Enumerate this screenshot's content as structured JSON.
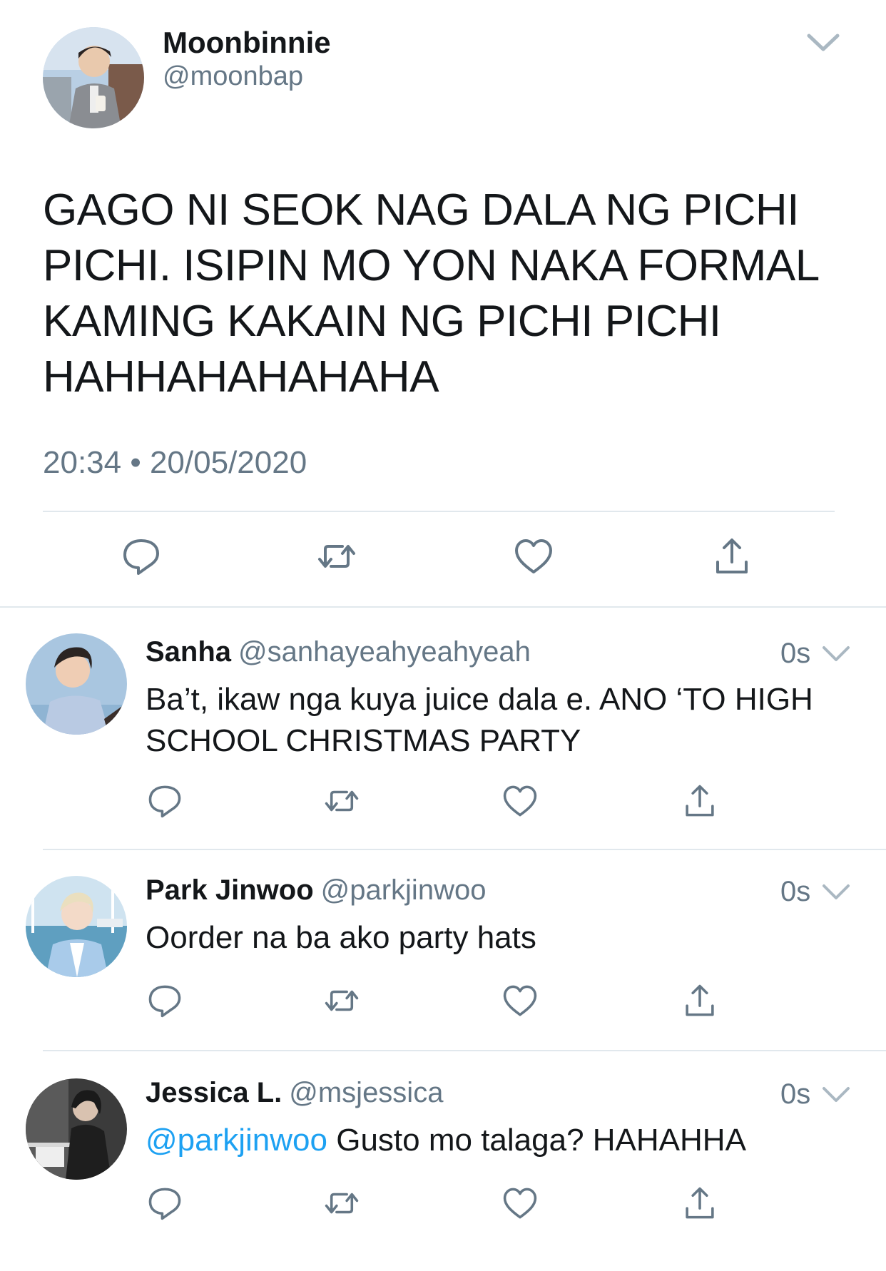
{
  "main_tweet": {
    "user_name": "Moonbinnie",
    "handle": "@moonbap",
    "text": "GAGO NI SEOK NAG DALA NG PICHI PICHI. ISIPIN MO YON NAKA FORMAL KAMING KAKAIN NG PICHI PICHI HAHHAHAHAHAHA",
    "meta": "20:34 • 20/05/2020",
    "avatar_icon": "avatar-photo-man-in-grey-blazer"
  },
  "replies": [
    {
      "user_name": "Sanha",
      "handle": "@sanhayeahyeahyeah",
      "time": "0s",
      "mention": "",
      "text": "Ba’t, ikaw nga kuya juice dala e. ANO ‘TO HIGH SCHOOL CHRISTMAS PARTY",
      "avatar_icon": "avatar-photo-man-in-blue-shirt"
    },
    {
      "user_name": "Park Jinwoo",
      "handle": "@parkjinwoo",
      "time": "0s",
      "mention": "",
      "text": "Oorder na ba ako party hats",
      "avatar_icon": "avatar-photo-man-at-marina"
    },
    {
      "user_name": "Jessica L.",
      "handle": "@msjessica",
      "time": "0s",
      "mention": "@parkjinwoo",
      "text": " Gusto mo talaga? HAHAHHA",
      "avatar_icon": "avatar-photo-woman-dark"
    }
  ],
  "icons": {
    "reply": "reply-icon",
    "retweet": "retweet-icon",
    "like": "like-icon",
    "share": "share-icon",
    "more": "chevron-down-icon"
  },
  "colors": {
    "text": "#14171a",
    "secondary": "#657786",
    "link": "#1da1f2",
    "divider": "#e1e8ed"
  }
}
